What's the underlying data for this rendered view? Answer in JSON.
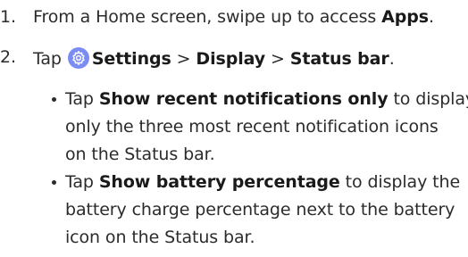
{
  "steps": [
    {
      "number": "1.",
      "text_before": "From a Home screen, swipe up to access ",
      "bold": "Apps",
      "text_after": "."
    },
    {
      "number": "2.",
      "tap": "Tap",
      "path1": "Settings",
      "sep1": " > ",
      "path2": "Display",
      "sep2": " > ",
      "path3": "Status bar",
      "end": "."
    }
  ],
  "bullets": [
    {
      "bold": "Show recent notifications only",
      "line1_prefix": "Tap ",
      "line1_suffix": " to display",
      "line2": "only the three most recent notification icons",
      "line3": "on the Status bar."
    },
    {
      "bold": "Show battery percentage",
      "line1_prefix": "Tap ",
      "line1_suffix": " to display the",
      "line2": "battery charge percentage next to the battery",
      "line3": "icon on the Status bar."
    }
  ],
  "icons": {
    "settings_icon": "gear-icon",
    "settings_color": "#7b8cf4"
  }
}
